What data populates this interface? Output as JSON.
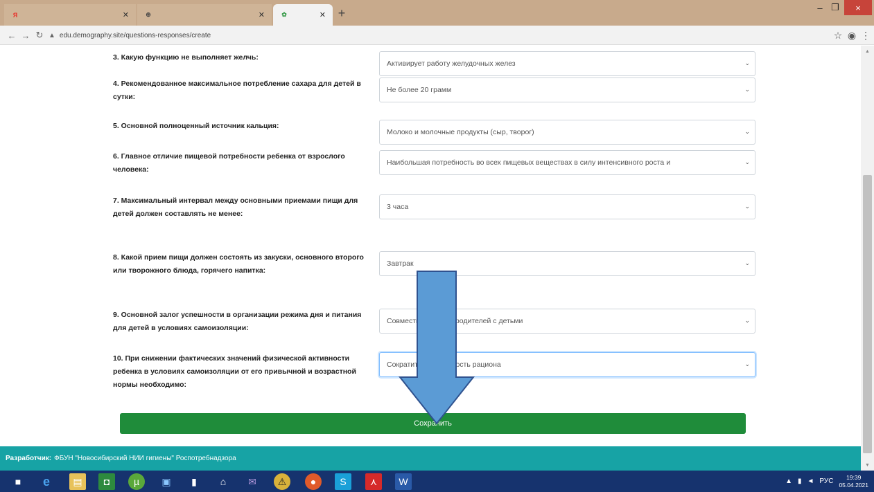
{
  "browser": {
    "tabs": [
      {
        "title": "",
        "favicon_char": "Я",
        "favicon_color": "#e8302a"
      },
      {
        "title": "",
        "favicon_char": "⊕",
        "favicon_color": "#444444"
      },
      {
        "title": "",
        "favicon_char": "✿",
        "favicon_color": "#3a9c4c"
      }
    ],
    "new_tab_symbol": "+",
    "window": {
      "minimize": "–",
      "maximize": "❐",
      "close": "×"
    },
    "address": {
      "url": "edu.demography.site/questions-responses/create"
    }
  },
  "questions": [
    {
      "label": "3. Какую функцию не выполняет желчь:",
      "answer": "Активирует работу желудочных желез"
    },
    {
      "label": "4. Рекомендованное максимальное потребление сахара для детей в сутки:",
      "answer": "Не более 20 грамм"
    },
    {
      "label": "5. Основной полноценный источник кальция:",
      "answer": "Молоко и молочные продукты (сыр, творог)"
    },
    {
      "label": "6. Главное отличие пищевой потребности ребенка от взрослого человека:",
      "answer": "Наибольшая потребность во всех пищевых веществах в силу интенсивного роста и"
    },
    {
      "label": "7. Максимальный интервал между основными приемами пищи для детей должен составлять не менее:",
      "answer": "3 часа"
    },
    {
      "label": "8. Какой прием пищи должен состоять из закуски, основного второго или творожного блюда, горячего напитка:",
      "answer": "Завтрак"
    },
    {
      "label": "9. Основной залог успешности в организации режима дня и питания для детей в условиях самоизоляции:",
      "answer": "Совместно питания родителей с детьми"
    },
    {
      "label": "10. При снижении фактических значений физической активности ребенка в условиях самоизоляции от его привычной и возрастной нормы необходимо:",
      "answer": "Сократить калорийность рациона"
    }
  ],
  "save_label": "Сохранить",
  "footer": {
    "developer_label": "Разработчик:",
    "developer_name": "ФБУН \"Новосибирский НИИ гигиены\" Роспотребнадзора"
  },
  "taskbar": {
    "icons": [
      "windows-logo",
      "ie",
      "explorer",
      "store",
      "utorrent",
      "monitor",
      "file",
      "home",
      "mail",
      "game",
      "chrome",
      "skype",
      "acrobat",
      "word"
    ],
    "time": "19:39",
    "date": "05.04.2021",
    "lang": "РУС"
  },
  "colors": {
    "save_button": "#1f8c3a",
    "footer": "#17a3a5",
    "arrow_fill": "#5b9bd5",
    "arrow_stroke": "#2f528f",
    "taskbar": "#16336e"
  }
}
